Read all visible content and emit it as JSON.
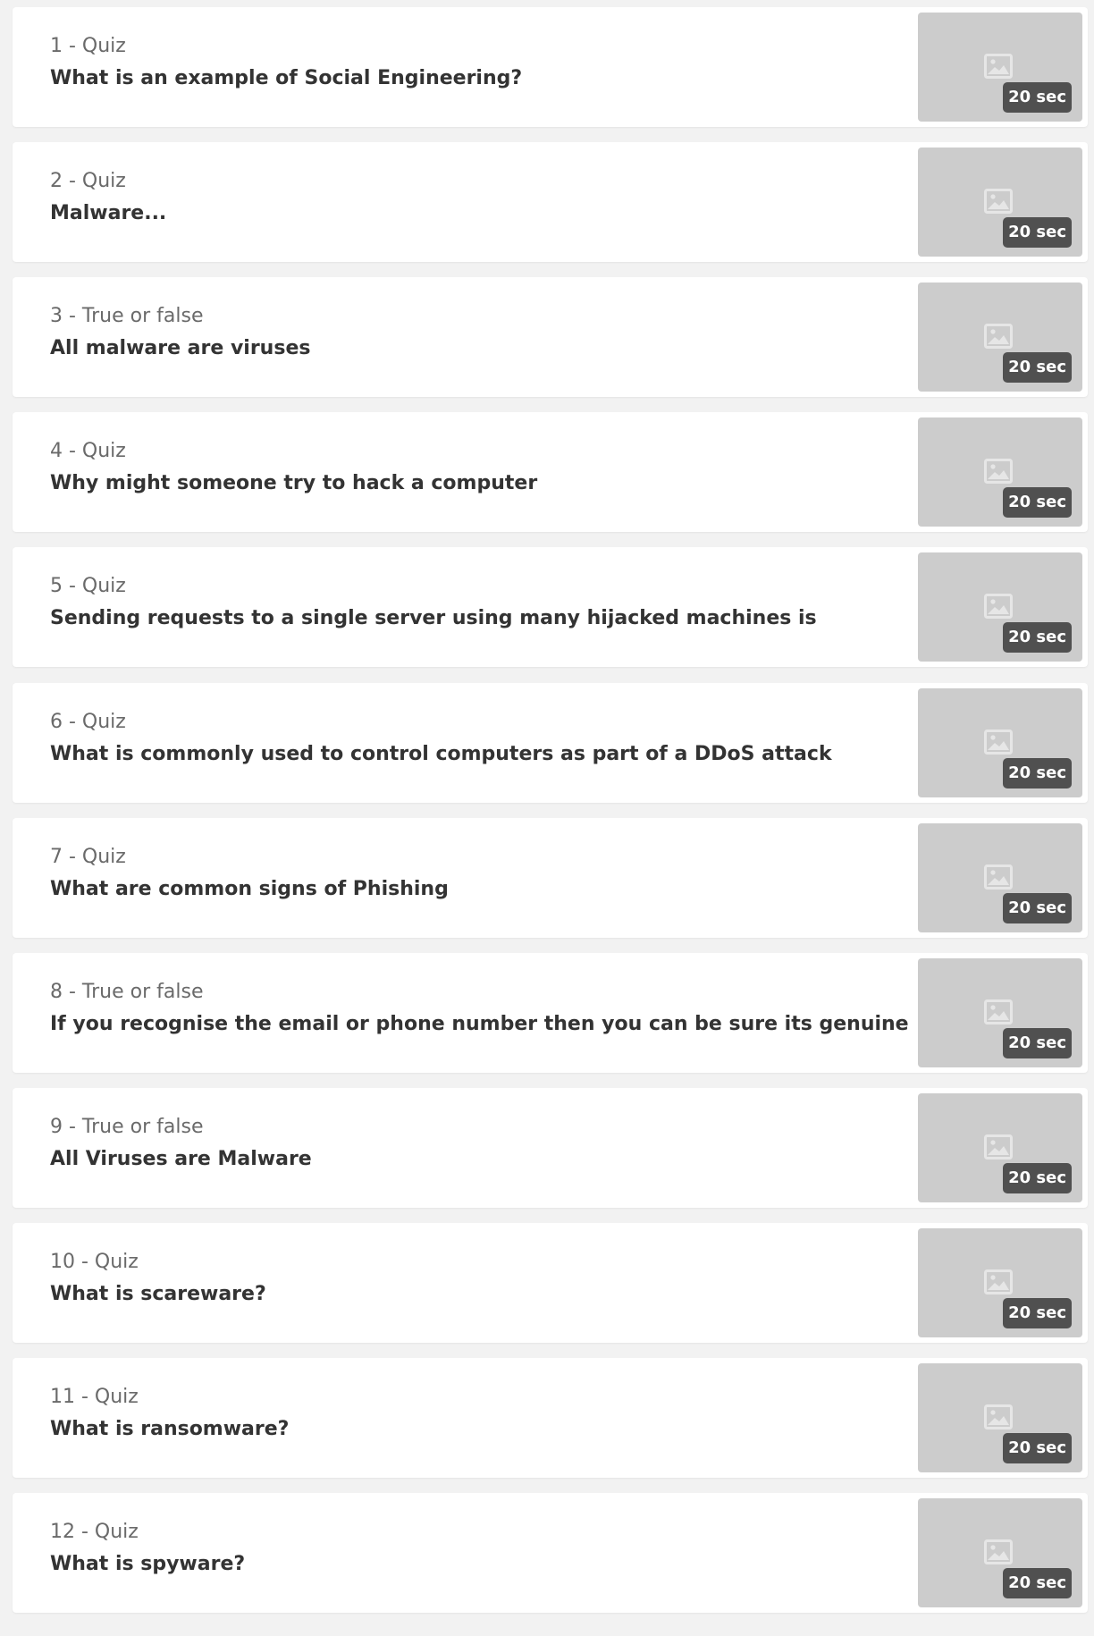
{
  "colors": {
    "page_background": "#f2f2f2",
    "card_background": "#ffffff",
    "thumbnail_background": "#cccccc",
    "badge_background": "#505050"
  },
  "questions": [
    {
      "type_label": "1 - Quiz",
      "title": "What is an example of Social Engineering?",
      "time_limit": "20 sec",
      "thumbnail_icon": "image-placeholder-icon"
    },
    {
      "type_label": "2 - Quiz",
      "title": "Malware...",
      "time_limit": "20 sec",
      "thumbnail_icon": "image-placeholder-icon"
    },
    {
      "type_label": "3 - True or false",
      "title": "All malware are viruses",
      "time_limit": "20 sec",
      "thumbnail_icon": "image-placeholder-icon"
    },
    {
      "type_label": "4 - Quiz",
      "title": "Why might someone try to hack a computer",
      "time_limit": "20 sec",
      "thumbnail_icon": "image-placeholder-icon"
    },
    {
      "type_label": "5 - Quiz",
      "title": "Sending requests to a single server using many hijacked machines is",
      "time_limit": "20 sec",
      "thumbnail_icon": "image-placeholder-icon"
    },
    {
      "type_label": "6 - Quiz",
      "title": "What is commonly used to control computers as part of a DDoS attack",
      "time_limit": "20 sec",
      "thumbnail_icon": "image-placeholder-icon"
    },
    {
      "type_label": "7 - Quiz",
      "title": "What are common signs of Phishing",
      "time_limit": "20 sec",
      "thumbnail_icon": "image-placeholder-icon"
    },
    {
      "type_label": "8 - True or false",
      "title": "If you recognise the email or phone number then you can be sure its genuine",
      "time_limit": "20 sec",
      "thumbnail_icon": "image-placeholder-icon"
    },
    {
      "type_label": "9 - True or false",
      "title": "All Viruses are Malware",
      "time_limit": "20 sec",
      "thumbnail_icon": "image-placeholder-icon"
    },
    {
      "type_label": "10 - Quiz",
      "title": "What is scareware?",
      "time_limit": "20 sec",
      "thumbnail_icon": "image-placeholder-icon"
    },
    {
      "type_label": "11 - Quiz",
      "title": "What is ransomware?",
      "time_limit": "20 sec",
      "thumbnail_icon": "image-placeholder-icon"
    },
    {
      "type_label": "12 - Quiz",
      "title": "What is spyware?",
      "time_limit": "20 sec",
      "thumbnail_icon": "image-placeholder-icon"
    }
  ]
}
